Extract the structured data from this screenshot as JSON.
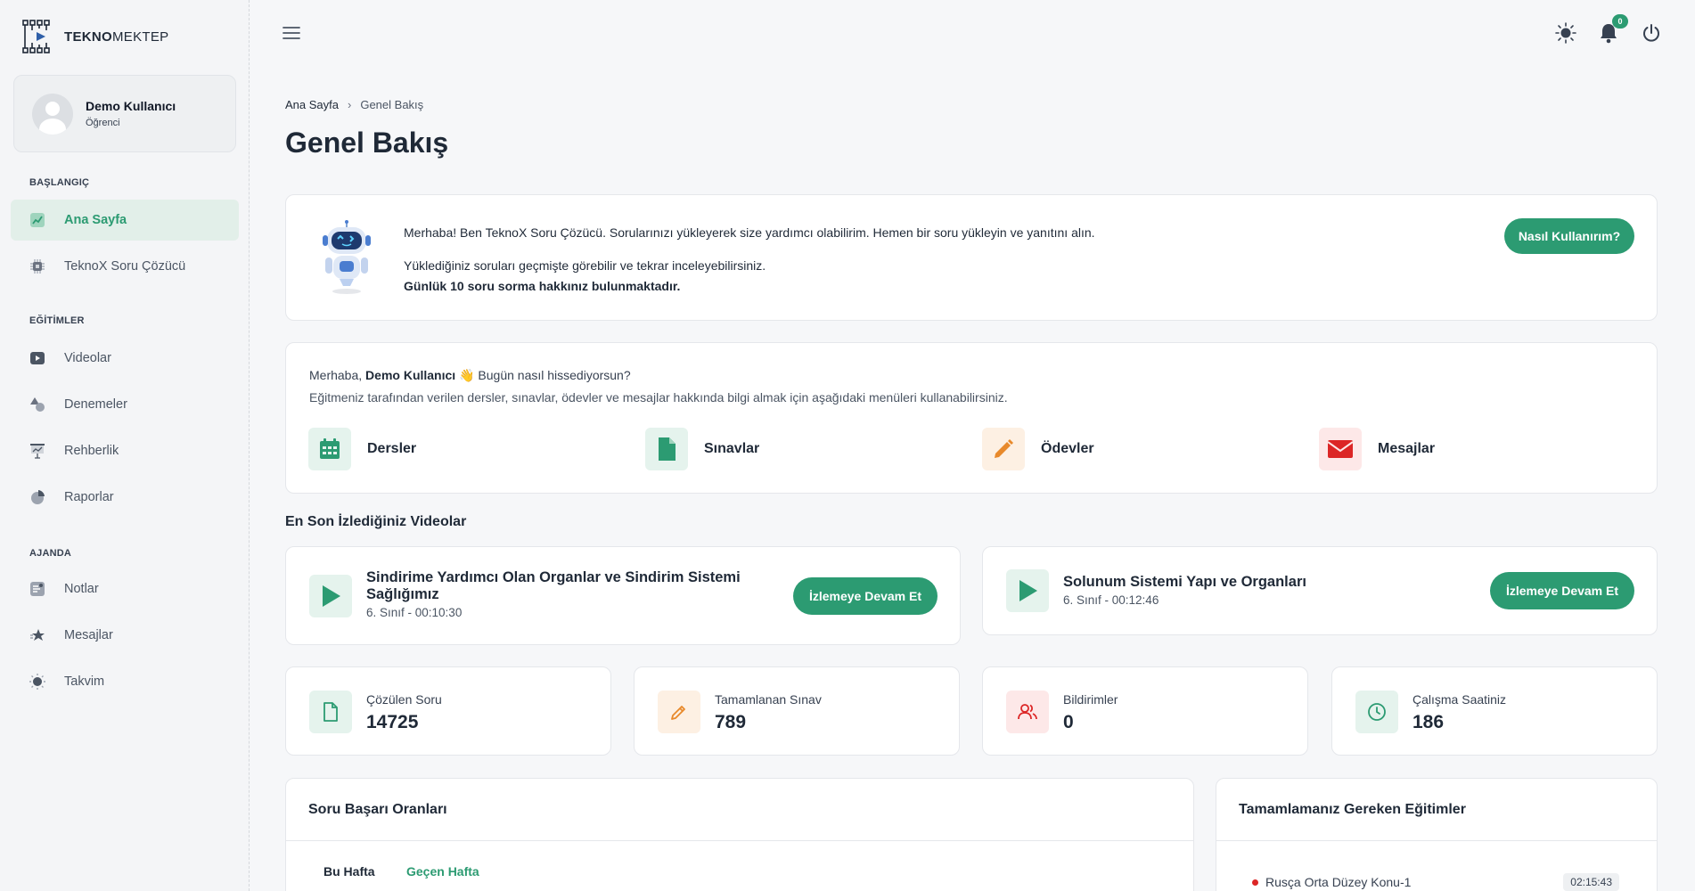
{
  "brand": {
    "bold": "TEKNO",
    "light": "MEKTEP",
    "logo_icon": "circuit-logo-icon"
  },
  "user": {
    "name": "Demo Kullanıcı",
    "role": "Öğrenci"
  },
  "sidebar": {
    "sections": [
      {
        "title": "BAŞLANGIÇ"
      },
      {
        "title": "EĞİTİMLER"
      },
      {
        "title": "AJANDA"
      }
    ],
    "items": [
      {
        "label": "Ana Sayfa",
        "icon": "chart-icon",
        "active": true
      },
      {
        "label": "TeknoX Soru Çözücü",
        "icon": "chip-icon"
      },
      {
        "label": "Videolar",
        "icon": "video-icon"
      },
      {
        "label": "Denemeler",
        "icon": "shapes-icon"
      },
      {
        "label": "Rehberlik",
        "icon": "presentation-icon"
      },
      {
        "label": "Raporlar",
        "icon": "pie-chart-icon"
      },
      {
        "label": "Notlar",
        "icon": "notes-icon"
      },
      {
        "label": "Mesajlar",
        "icon": "star-chat-icon"
      },
      {
        "label": "Takvim",
        "icon": "sun-icon"
      }
    ]
  },
  "topbar": {
    "notification_count": "0",
    "icons": [
      "menu-icon",
      "sun-icon",
      "bell-icon",
      "power-icon"
    ]
  },
  "breadcrumb": {
    "home": "Ana Sayfa",
    "current": "Genel Bakış"
  },
  "page_title": "Genel Bakış",
  "robot_card": {
    "line1": "Merhaba! Ben TeknoX Soru Çözücü. Sorularınızı yükleyerek size yardımcı olabilirim. Hemen bir soru yükleyin ve yanıtını alın.",
    "line2": "Yüklediğiniz soruları geçmişte görebilir ve tekrar inceleyebilirsiniz.",
    "line3": "Günlük 10 soru sorma hakkınız bulunmaktadır.",
    "button": "Nasıl Kullanırım?"
  },
  "welcome": {
    "greeting_prefix": "Merhaba, ",
    "greeting_name": "Demo Kullanıcı",
    "greeting_emoji": "👋",
    "greeting_suffix": " Bugün nasıl hissediyorsun?",
    "subtitle": "Eğitmeniz tarafından verilen dersler, sınavlar, ödevler ve mesajlar hakkında bilgi almak için aşağıdaki menüleri kullanabilirsiniz.",
    "links": [
      {
        "label": "Dersler",
        "icon": "calendar-icon",
        "color": "#2c9b72"
      },
      {
        "label": "Sınavlar",
        "icon": "document-icon",
        "color": "#2c9b72"
      },
      {
        "label": "Ödevler",
        "icon": "pencil-icon",
        "color": "#e8892b"
      },
      {
        "label": "Mesajlar",
        "icon": "envelope-icon",
        "color": "#dc2626"
      }
    ]
  },
  "recent_videos": {
    "title": "En Son İzlediğiniz Videolar",
    "items": [
      {
        "title_line1": "Sindirime Yardımcı Olan Organlar ve Sindirim Sistemi",
        "title_line2": "Sağlığımız",
        "meta": "6. Sınıf - 00:10:30",
        "button": "İzlemeye Devam Et"
      },
      {
        "title_line1": "Solunum Sistemi Yapı ve Organları",
        "meta": "6. Sınıf - 00:12:46",
        "button": "İzlemeye Devam Et"
      }
    ]
  },
  "stats": [
    {
      "label": "Çözülen Soru",
      "value": "14725",
      "icon": "file-icon",
      "color": "#2c9b72"
    },
    {
      "label": "Tamamlanan Sınav",
      "value": "789",
      "icon": "pencil-icon",
      "color": "#e8892b"
    },
    {
      "label": "Bildirimler",
      "value": "0",
      "icon": "users-icon",
      "color": "#dc2626"
    },
    {
      "label": "Çalışma Saatiniz",
      "value": "186",
      "icon": "clock-icon",
      "color": "#2c9b72"
    }
  ],
  "success_rates": {
    "title": "Soru Başarı Oranları",
    "tabs": [
      "Bu Hafta",
      "Geçen Hafta"
    ]
  },
  "todo": {
    "title": "Tamamlamanız Gereken Eğitimler",
    "items": [
      {
        "label": "Rusça Orta Düzey Konu-1",
        "time": "02:15:43"
      }
    ]
  }
}
